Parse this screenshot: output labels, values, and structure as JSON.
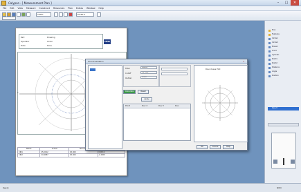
{
  "window": {
    "title": "Calypso - [ Measurement Plan ]",
    "min": "–",
    "max": "□",
    "close": "✕"
  },
  "menu": [
    "File",
    "Edit",
    "View",
    "Measure",
    "Construct",
    "Resources",
    "Plan",
    "Extras",
    "Window",
    "Help"
  ],
  "toolbar": {
    "zoom_value": "100%",
    "combo_value": "Probe 1"
  },
  "report": {
    "logo": "ZEISS",
    "header_labels": [
      "Part",
      "Operator",
      "Date",
      "Drawing",
      "Order",
      "Time"
    ],
    "bottom_table": {
      "headers": [
        "Name",
        "Actual",
        "Nominal",
        "Dev"
      ],
      "rows": [
        [
          "CIR1",
          "25.0012",
          "25.000",
          "0.0012"
        ],
        [
          "CIR2",
          "24.9987",
          "25.000",
          "-0.0013"
        ]
      ]
    },
    "side_label": "Y"
  },
  "dialog": {
    "title": "Form Evaluation",
    "fields": {
      "a_label": "Filter",
      "a_value": "Gauss",
      "b_label": "Cutoff",
      "b_value": "50 UPR",
      "c_label": "Outlier",
      "c_value": "None"
    },
    "ok_label": "OK",
    "cancel_label": "Cancel",
    "apply_label": "Apply",
    "help_label": "Help",
    "calc_label": "Calculate",
    "reset_label": "Reset",
    "table_headers": [
      "Point",
      "Dev X",
      "Dev Y",
      "Dev"
    ],
    "plot_title": "Roundness Plot"
  },
  "tree": {
    "items": [
      "Plan",
      "Features",
      "Circle1",
      "Circle2",
      "Plane1",
      "Line1",
      "Cylinder",
      "Point1",
      "Point2",
      "Distance",
      "Angle",
      "Position",
      "Result"
    ],
    "selected": "Result"
  },
  "statusbar": {
    "text": "Ready",
    "num": "NUM"
  }
}
